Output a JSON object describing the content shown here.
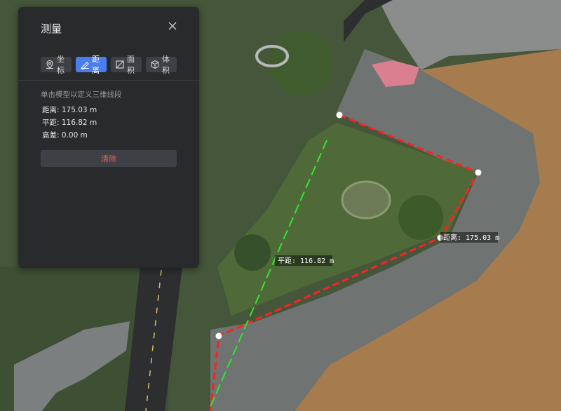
{
  "panel": {
    "title": "测量",
    "close_icon": "close-icon",
    "tabs": [
      {
        "label": "坐标",
        "icon": "location-pin-icon",
        "active": false
      },
      {
        "label": "距离",
        "icon": "ruler-pencil-icon",
        "active": true
      },
      {
        "label": "面积",
        "icon": "area-square-icon",
        "active": false
      },
      {
        "label": "体积",
        "icon": "cube-icon",
        "active": false
      }
    ],
    "hint": "单击模型以定义三维线段",
    "readouts": {
      "distance": "距离: 175.03 m",
      "horizontal": "平距: 116.82 m",
      "height": "高差: 0.00 m"
    },
    "clear_label": "清除"
  },
  "map": {
    "distance_label": "距离: 175.03 m",
    "horizontal_label": "平距: 116.82 m"
  },
  "colors": {
    "accent": "#4a7df0",
    "danger": "#f05a5a",
    "measure_line": "#ff2020",
    "horizontal_line": "#2ee82e",
    "water": "#a67c4f"
  }
}
